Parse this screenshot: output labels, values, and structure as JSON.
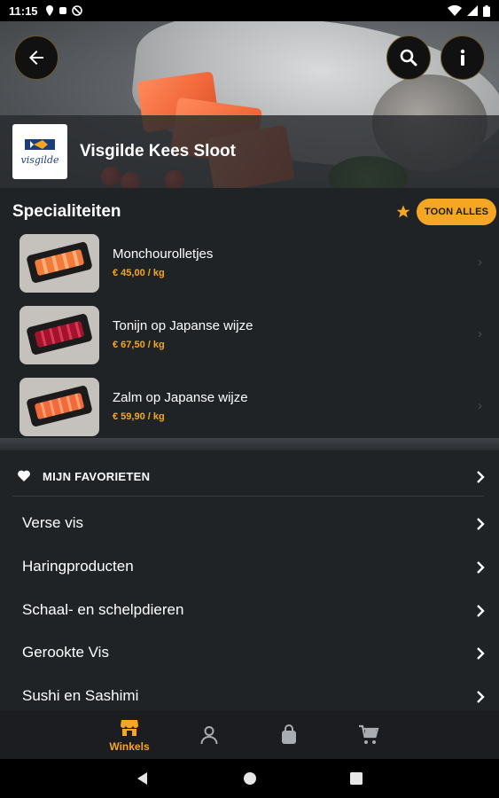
{
  "status_bar": {
    "time": "11:15"
  },
  "store": {
    "name": "Visgilde Kees Sloot",
    "logo_text": "visgilde"
  },
  "specials": {
    "heading": "Specialiteiten",
    "show_all_label": "TOON ALLES",
    "items": [
      {
        "name": "Monchourolletjes",
        "price": "€ 45,00 / kg"
      },
      {
        "name": "Tonijn op Japanse wijze",
        "price": "€ 67,50 / kg"
      },
      {
        "name": "Zalm op Japanse wijze",
        "price": "€ 59,90 / kg"
      }
    ]
  },
  "menu": {
    "favorites_label": "MIJN FAVORIETEN",
    "categories": [
      {
        "label": "Verse vis"
      },
      {
        "label": "Haringproducten"
      },
      {
        "label": "Schaal- en schelpdieren"
      },
      {
        "label": "Gerookte Vis"
      },
      {
        "label": "Sushi en Sashimi"
      }
    ]
  },
  "bottom_nav": {
    "items": [
      {
        "label": "Winkels",
        "icon": "shop-icon",
        "active": true
      },
      {
        "label": "",
        "icon": "account-icon",
        "active": false
      },
      {
        "label": "",
        "icon": "bag-icon",
        "active": false
      },
      {
        "label": "",
        "icon": "cart-icon",
        "active": false
      }
    ]
  },
  "colors": {
    "accent": "#f5a623",
    "background": "#202326",
    "nav": "#1b1d20"
  }
}
